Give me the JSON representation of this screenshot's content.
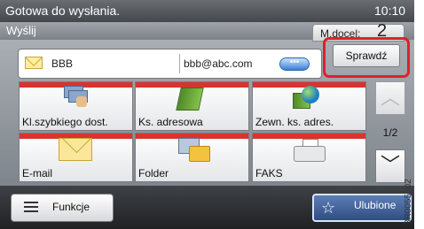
{
  "status": {
    "message": "Gotowa do wysłania.",
    "time": "10:10"
  },
  "title": {
    "text": "Wyślij"
  },
  "copies": {
    "label": "M.docel:",
    "value": "2"
  },
  "destination": {
    "name": "BBB",
    "email": "bbb@abc.com",
    "bubble_icon": "chat-bubble-icon"
  },
  "check_button": {
    "label": "Sprawdź"
  },
  "tiles": [
    {
      "label": "Kl.szybkiego dost.",
      "icon": "speed-dial-icon"
    },
    {
      "label": "Ks. adresowa",
      "icon": "address-book-icon"
    },
    {
      "label": "Zewn. ks. adres.",
      "icon": "external-address-book-icon"
    },
    {
      "label": "E-mail",
      "icon": "email-icon"
    },
    {
      "label": "Folder",
      "icon": "folder-icon"
    },
    {
      "label": "FAKS",
      "icon": "fax-icon"
    }
  ],
  "pager": {
    "indicator": "1/2"
  },
  "bottom": {
    "functions_label": "Funkcje",
    "favorites_label": "Ulubione"
  },
  "side_code": "3R0055_02",
  "colors": {
    "highlight": "#e0202a",
    "tile_stripe": "#d8342d",
    "favorites": "#2f4c83"
  }
}
